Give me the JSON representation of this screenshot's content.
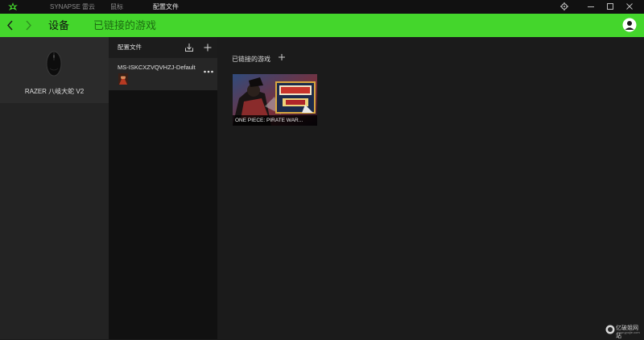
{
  "topnav": {
    "items": [
      {
        "label": "SYNAPSE 雷云",
        "active": false
      },
      {
        "label": "鼠标",
        "active": false
      },
      {
        "label": "配置文件",
        "active": true
      }
    ]
  },
  "greenbar": {
    "section": "设备",
    "subsection": "已链接的游戏"
  },
  "device": {
    "name": "RAZER 八岐大蛇 V2"
  },
  "profiles": {
    "title": "配置文件",
    "items": [
      {
        "name": "MS-ISKCXZVQVHZJ-Default"
      }
    ]
  },
  "linked_games": {
    "title": "已链接的游戏",
    "games": [
      {
        "label": "ONE PIECE: PIRATE WAR..."
      }
    ]
  },
  "watermark": {
    "text": "亿破姐网站",
    "sub": "www.ypojie.com"
  },
  "colors": {
    "accent": "#44d62c",
    "titlebar": "#111111",
    "background": "#1b1b1b"
  }
}
